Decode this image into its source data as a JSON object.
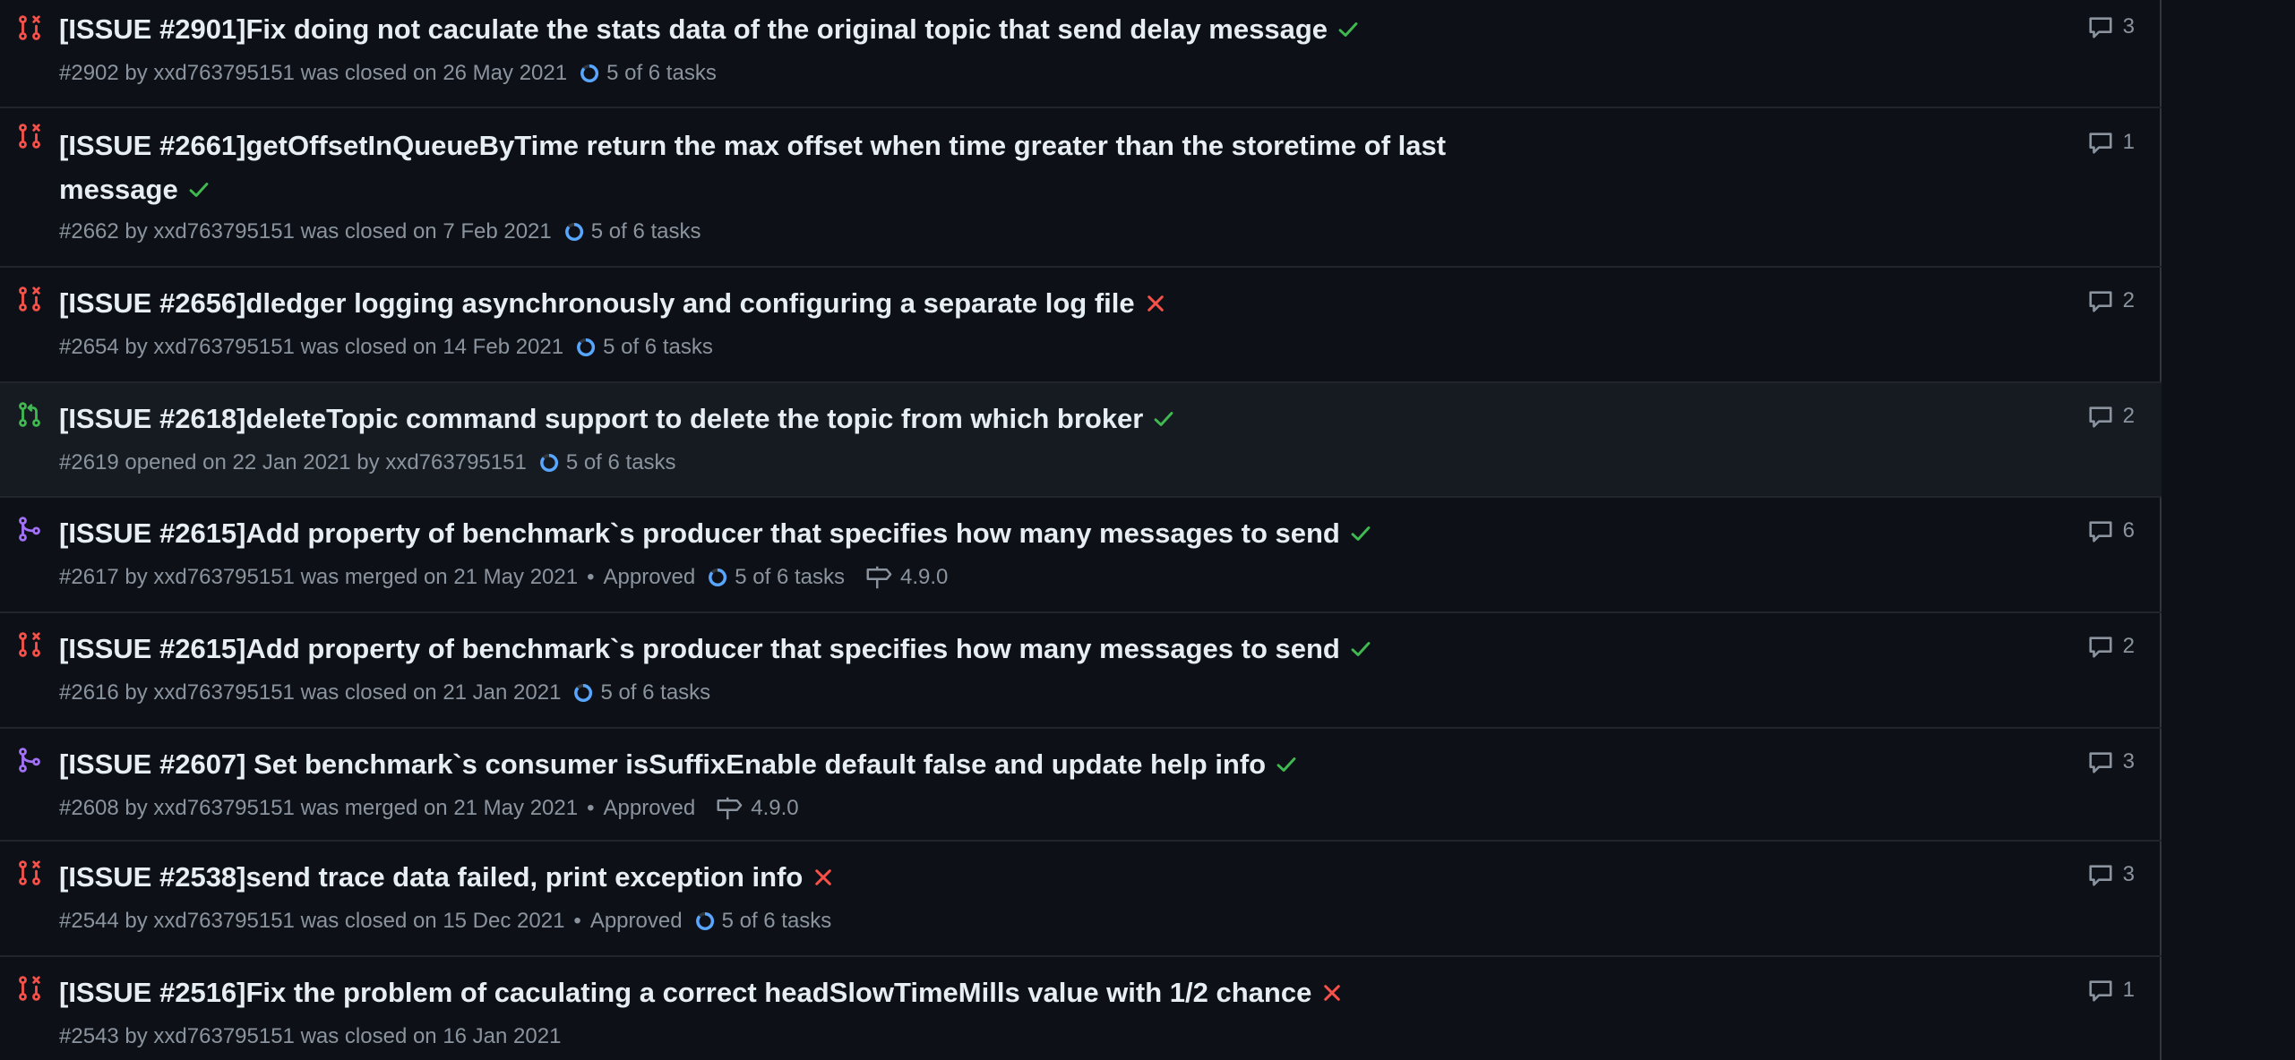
{
  "colors": {
    "closed": "#f85149",
    "open": "#3fb950",
    "merged": "#a371f7",
    "check": "#3fb950",
    "fail": "#f85149",
    "progress": "#58a6ff"
  },
  "rows": [
    {
      "state": "closed",
      "title": "[ISSUE #2901]Fix doing not caculate the stats data of the original topic that send delay message",
      "status": "check",
      "meta": "#2902 by xxd763795151 was closed on 26 May 2021",
      "approved": "",
      "tasks": "5 of 6 tasks",
      "milestone": "",
      "comments": "3"
    },
    {
      "state": "closed",
      "title": "[ISSUE #2661]getOffsetInQueueByTime return the max offset when time greater than the storetime of last message",
      "status": "check",
      "meta": "#2662 by xxd763795151 was closed on 7 Feb 2021",
      "approved": "",
      "tasks": "5 of 6 tasks",
      "milestone": "",
      "comments": "1"
    },
    {
      "state": "closed",
      "title": "[ISSUE #2656]dledger logging asynchronously and configuring a separate log file",
      "status": "fail",
      "meta": "#2654 by xxd763795151 was closed on 14 Feb 2021",
      "approved": "",
      "tasks": "5 of 6 tasks",
      "milestone": "",
      "comments": "2"
    },
    {
      "state": "open",
      "title": "[ISSUE #2618]deleteTopic command support to delete the topic from which broker",
      "status": "check",
      "meta": "#2619 opened on 22 Jan 2021 by xxd763795151",
      "approved": "",
      "tasks": "5 of 6 tasks",
      "milestone": "",
      "comments": "2"
    },
    {
      "state": "merged",
      "title": "[ISSUE #2615]Add property of benchmark`s producer that specifies how many messages to send",
      "status": "check",
      "meta": "#2617 by xxd763795151 was merged on 21 May 2021",
      "approved": "Approved",
      "tasks": "5 of 6 tasks",
      "milestone": "4.9.0",
      "comments": "6"
    },
    {
      "state": "closed",
      "title": "[ISSUE #2615]Add property of benchmark`s producer that specifies how many messages to send",
      "status": "check",
      "meta": "#2616 by xxd763795151 was closed on 21 Jan 2021",
      "approved": "",
      "tasks": "5 of 6 tasks",
      "milestone": "",
      "comments": "2"
    },
    {
      "state": "merged",
      "title": "[ISSUE #2607] Set benchmark`s consumer isSuffixEnable default false and update help info",
      "status": "check",
      "meta": "#2608 by xxd763795151 was merged on 21 May 2021",
      "approved": "Approved",
      "tasks": "",
      "milestone": "4.9.0",
      "comments": "3"
    },
    {
      "state": "closed",
      "title": "[ISSUE #2538]send trace data failed, print exception info",
      "status": "fail",
      "meta": "#2544 by xxd763795151 was closed on 15 Dec 2021",
      "approved": "Approved",
      "tasks": "5 of 6 tasks",
      "milestone": "",
      "comments": "3"
    },
    {
      "state": "closed",
      "title": "[ISSUE #2516]Fix the problem of caculating a correct headSlowTimeMills value with 1/2 chance",
      "status": "fail",
      "meta": "#2543 by xxd763795151 was closed on 16 Jan 2021",
      "approved": "",
      "tasks": "",
      "milestone": "",
      "comments": "1"
    }
  ]
}
